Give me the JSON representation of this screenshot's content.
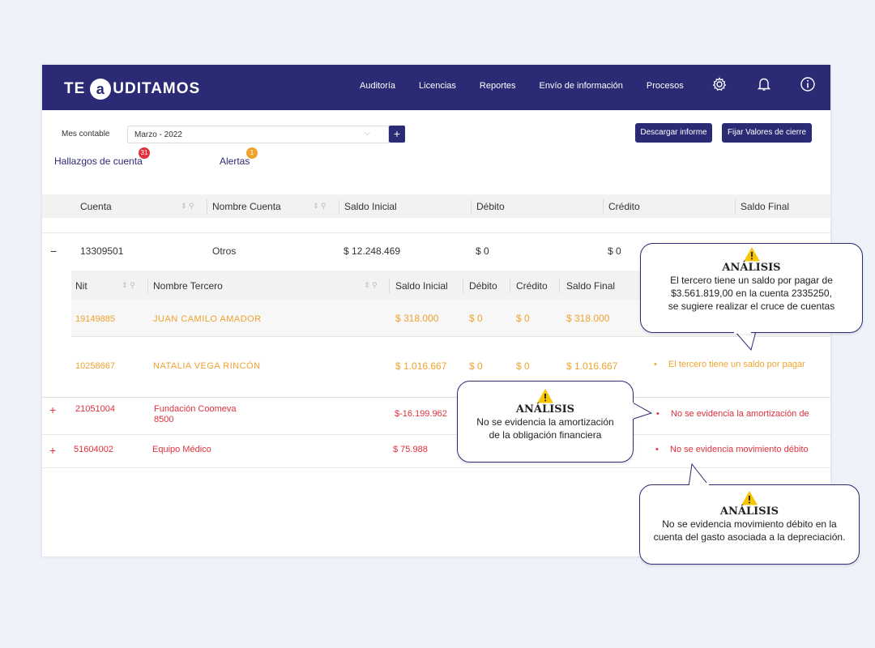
{
  "brand": {
    "pre": "TE",
    "letter": "a",
    "post": "UDITAMOS"
  },
  "nav": [
    "Auditoría",
    "Licencias",
    "Reportes",
    "Envío de información",
    "Procesos"
  ],
  "icons": {
    "settings": "gear-icon",
    "notifications": "bell-icon",
    "info": "info-icon"
  },
  "filters": {
    "label": "Mes contable",
    "value": "Marzo - 2022"
  },
  "buttons": {
    "download": "Descargar informe",
    "closing": "Fijar Valores de cierre"
  },
  "tabs": [
    {
      "label": "Hallazgos de cuenta",
      "count": "31",
      "color": "#e0303b"
    },
    {
      "label": "Alertas",
      "count": "1",
      "color": "#f0a22e"
    }
  ],
  "table": {
    "headers": [
      "Cuenta",
      "Nombre Cuenta",
      "Saldo Inicial",
      "Débito",
      "Crédito",
      "Saldo Final"
    ],
    "expanded_row": {
      "toggle": "−",
      "cuenta": "13309501",
      "nombre": "Otros",
      "saldo_inicial": "$ 12.248.469",
      "debito": "$ 0",
      "credito": "$ 0"
    },
    "sub_headers": [
      "Nit",
      "Nombre Tercero",
      "Saldo Inicial",
      "Débito",
      "Crédito",
      "Saldo Final"
    ],
    "sub_rows": [
      {
        "nit": "19149885",
        "nombre": "JUAN CAMILO AMADOR",
        "saldo_inicial": "$ 318.000",
        "debito": "$ 0",
        "credito": "$ 0",
        "saldo_final": "$ 318.000",
        "alert": ""
      },
      {
        "nit": "10258667",
        "nombre": "NATALIA VEGA RINCÓN",
        "saldo_inicial": "$ 1.016.667",
        "debito": "$ 0",
        "credito": "$ 0",
        "saldo_final": "$ 1.016.667",
        "alert": "El tercero tiene un saldo por pagar"
      }
    ],
    "rows": [
      {
        "toggle": "+",
        "cuenta": "21051004",
        "nombre_1": "Fundación Coomeva",
        "nombre_2": "8500",
        "saldo_inicial": "$-16.199.962",
        "alert": "No se evidencia la amortización de"
      },
      {
        "toggle": "+",
        "cuenta": "51604002",
        "nombre_1": "Equipo Médico",
        "saldo_inicial": "$ 75.988",
        "alert": "No se evidencia movimiento débito"
      }
    ]
  },
  "bubbles": [
    {
      "title": "ANÁLISIS",
      "lines": [
        "El tercero tiene un saldo por pagar de",
        "$3.561.819,00 en la cuenta 2335250,",
        "se sugiere realizar el cruce de cuentas"
      ]
    },
    {
      "title": "ANÁLISIS",
      "lines": [
        "No se evidencia la amortización",
        "de la obligación financiera"
      ]
    },
    {
      "title": "ANÁLISIS",
      "lines": [
        "No se evidencia movimiento débito en la",
        "cuenta del gasto asociada a la depreciación."
      ]
    }
  ],
  "colors": {
    "primary": "#2b2a74",
    "alert_orange": "#f0a22e",
    "alert_red": "#e0303b"
  }
}
